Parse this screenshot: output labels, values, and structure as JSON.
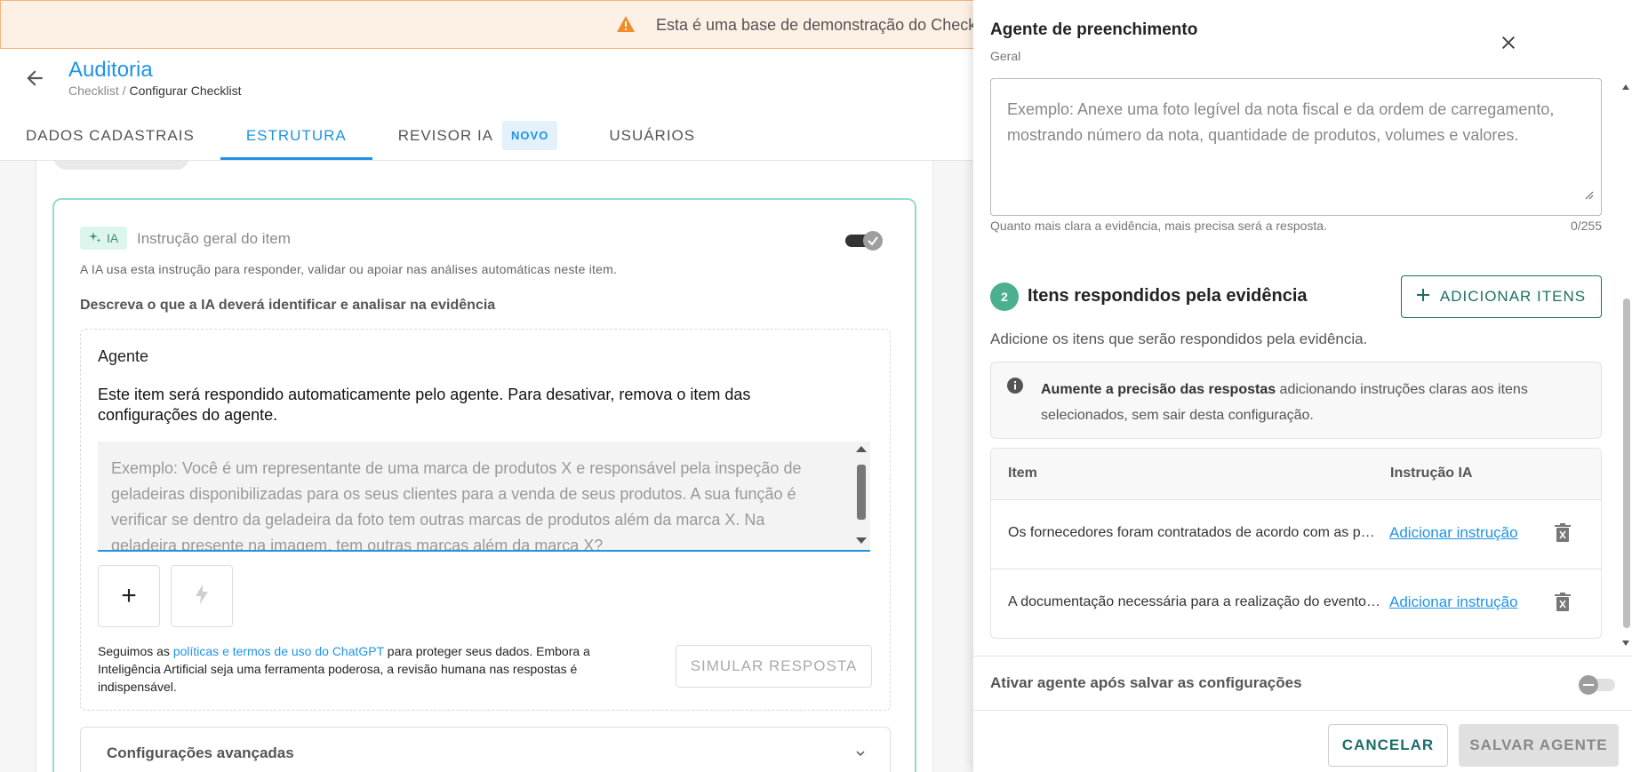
{
  "banner": {
    "text": "Esta é uma base de demonstração do Checkl"
  },
  "header": {
    "title": "Auditoria",
    "breadcrumb_parent": "Checklist",
    "breadcrumb_sep": " / ",
    "breadcrumb_current": "Configurar Checklist"
  },
  "tabs": [
    {
      "label": "DADOS CADASTRAIS"
    },
    {
      "label": "ESTRUTURA",
      "active": true
    },
    {
      "label": "REVISOR IA",
      "badge": "NOVO"
    },
    {
      "label": "USUÁRIOS"
    }
  ],
  "ia_card": {
    "badge": "IA",
    "title": "Instrução geral do item",
    "toggle_on": true,
    "description": "A IA usa esta instrução para responder, validar ou apoiar nas análises automáticas neste item.",
    "subtitle": "Descreva o que a IA deverá identificar e analisar na evidência",
    "agent_label": "Agente",
    "agent_text": "Este item será respondido automaticamente pelo agente. Para desativar, remova o item das configurações do agente.",
    "prompt_placeholder": "Exemplo: Você é um representante de uma marca de produtos X e responsável pela inspeção de geladeiras disponibilizadas para os seus clientes para a venda de seus produtos. A sua função é verificar se dentro da geladeira da foto tem outras marcas de produtos além da marca X. Na geladeira presente na imagem, tem outras marcas além da marca X?",
    "policy_before": "Seguimos as ",
    "policy_link": "políticas e termos de uso do ChatGPT",
    "policy_after": " para proteger seus dados. Embora a Inteligência Artificial seja uma ferramenta poderosa, a revisão humana nas respostas é indispensável.",
    "simulate_button": "SIMULAR RESPOSTA",
    "advanced_label": "Configurações avançadas"
  },
  "drawer": {
    "title": "Agente de preenchimento",
    "subtitle": "Geral",
    "evidence_placeholder": "Exemplo: Anexe uma foto legível da nota fiscal e da ordem de carregamento, mostrando número da nota, quantidade de produtos, volumes e valores.",
    "evidence_hint": "Quanto mais clara a evidência, mais precisa será a resposta.",
    "evidence_count": "0/255",
    "step_number": "2",
    "step_title": "Itens respondidos pela evidência",
    "add_items_button": "ADICIONAR ITENS",
    "add_items_desc": "Adicione os itens que serão respondidos pela evidência.",
    "info_bold": "Aumente a precisão das respostas",
    "info_rest": " adicionando instruções claras aos itens selecionados, sem sair desta configuração.",
    "table": {
      "col_item": "Item",
      "col_instruction": "Instrução IA",
      "rows": [
        {
          "item": "Os fornecedores foram contratados de acordo com as políticas da empresa?",
          "action": "Adicionar instrução"
        },
        {
          "item": "A documentação necessária para a realização do evento está completa?",
          "action": "Adicionar instrução"
        }
      ]
    },
    "activate_label": "Ativar agente após salvar as configurações",
    "activate_on": false,
    "cancel_button": "CANCELAR",
    "save_button": "SALVAR AGENTE"
  },
  "colors": {
    "primary": "#1f93e6",
    "accent_green": "#1b6f66",
    "step_green": "#4ab08f",
    "banner_bg": "#fdf1e6",
    "warning": "#f28c28"
  },
  "icons": [
    "warning-icon",
    "arrow-left-icon",
    "sparkle-icon",
    "close-icon",
    "plus-icon",
    "bolt-icon",
    "info-icon",
    "delete-icon",
    "chevron-down-icon",
    "resize-handle-icon"
  ]
}
